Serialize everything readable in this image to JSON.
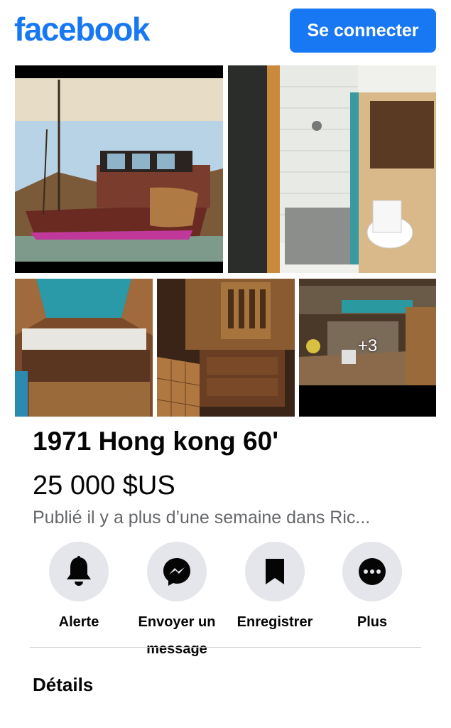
{
  "header": {
    "logo_text": "facebook",
    "connect_label": "Se connecter"
  },
  "gallery": {
    "photos": [
      {
        "subject": "boat-exterior"
      },
      {
        "subject": "bathroom"
      },
      {
        "subject": "cabin-berth"
      },
      {
        "subject": "carved-cabinets"
      },
      {
        "subject": "galley"
      }
    ],
    "more_count": "+3"
  },
  "listing": {
    "title": "1971 Hong kong 60'",
    "price": "25 000 $US",
    "meta": "Publié il y a plus d’une semaine dans Ric..."
  },
  "actions": [
    {
      "label": "Alerte",
      "icon": "bell-icon"
    },
    {
      "label": "Envoyer un message",
      "icon": "messenger-icon"
    },
    {
      "label": "Enregistrer",
      "icon": "bookmark-icon"
    },
    {
      "label": "Plus",
      "icon": "more-icon"
    }
  ],
  "section": {
    "details_label": "Détails"
  },
  "colors": {
    "brand": "#1877f2",
    "secondary_text": "#65676b",
    "icon_bg": "#e4e6eb"
  }
}
